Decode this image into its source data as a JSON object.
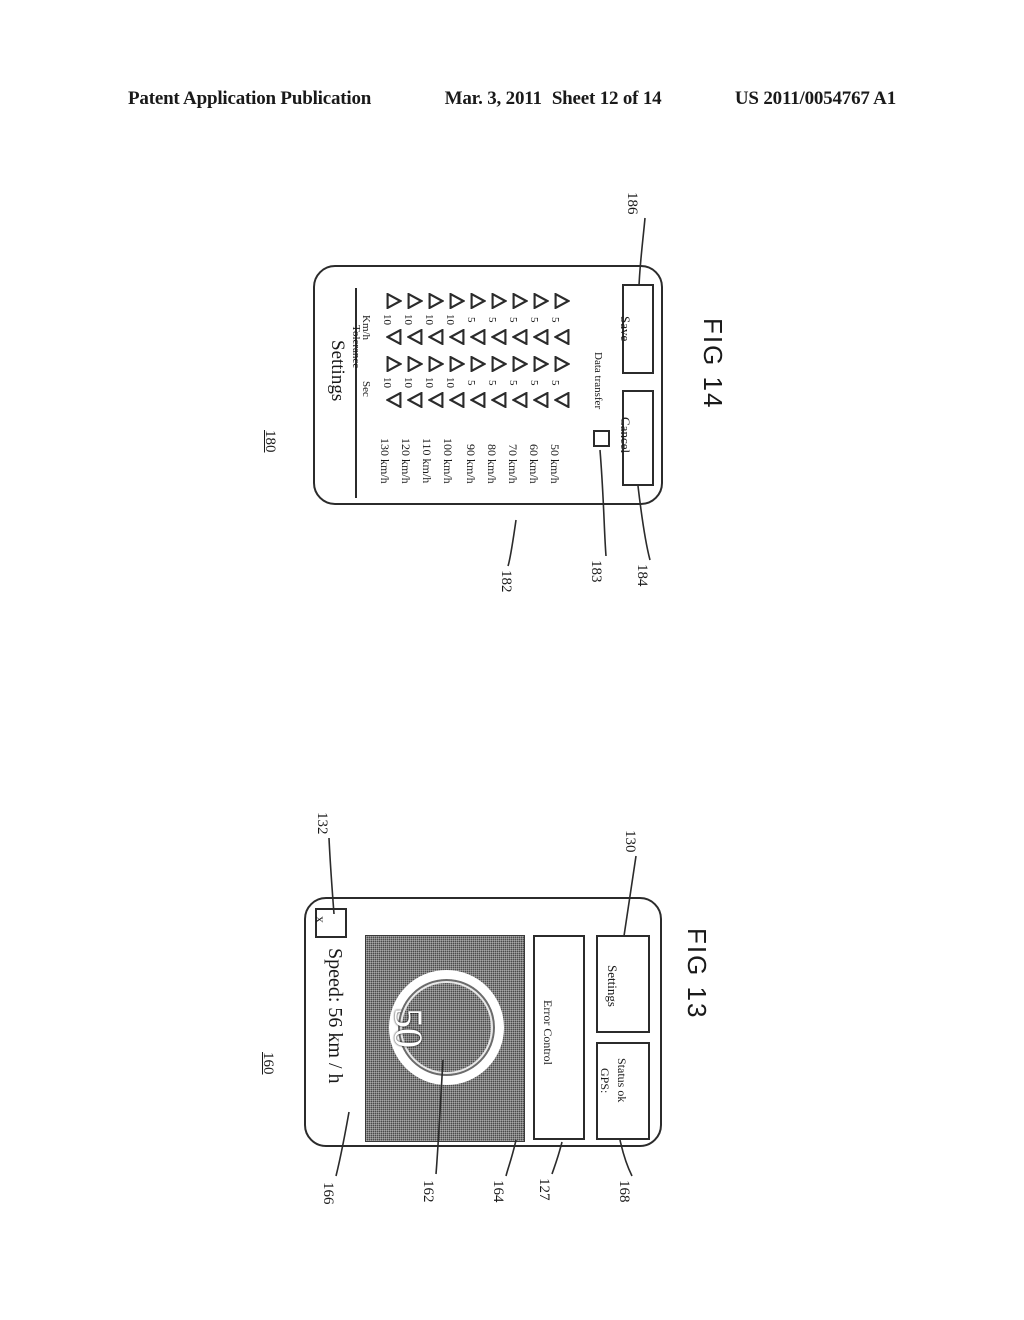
{
  "page": {
    "header_left": "Patent Application Publication",
    "header_date": "Mar. 3, 2011",
    "header_sheet": "Sheet 12 of 14",
    "header_pub": "US 2011/0054767 A1"
  },
  "fig14": {
    "caption": "FIG 14",
    "device_ref": "180",
    "title": "Settings",
    "col_header_tolerance": "Tolerance",
    "col_header_kmh": "Km/h",
    "col_header_sec": "Sec",
    "rows": [
      {
        "speed": "130 km/h",
        "sec": "10",
        "kmh": "10"
      },
      {
        "speed": "120 km/h",
        "sec": "10",
        "kmh": "10"
      },
      {
        "speed": "110 km/h",
        "sec": "10",
        "kmh": "10"
      },
      {
        "speed": "100 km/h",
        "sec": "10",
        "kmh": "10"
      },
      {
        "speed": "90 km/h",
        "sec": "5",
        "kmh": "5"
      },
      {
        "speed": "80 km/h",
        "sec": "5",
        "kmh": "5"
      },
      {
        "speed": "70 km/h",
        "sec": "5",
        "kmh": "5"
      },
      {
        "speed": "60 km/h",
        "sec": "5",
        "kmh": "5"
      },
      {
        "speed": "50 km/h",
        "sec": "5",
        "kmh": "5"
      }
    ],
    "data_transfer_label": "Data transfer",
    "data_transfer_checked": false,
    "save_label": "Save",
    "cancel_label": "Cancel",
    "ref_rows": "182",
    "ref_checkbox": "183",
    "ref_cancel": "184",
    "ref_save": "186"
  },
  "fig13": {
    "caption": "FIG 13",
    "device_ref": "160",
    "speed_label": "Speed: 56 km / h",
    "close_label": "x",
    "gauge_value": "50",
    "error_control_label": "Error Control",
    "settings_label": "Settings",
    "gps_label": "GPS:",
    "gps_status": "Status ok",
    "ref_speed_label": "166",
    "ref_gauge_value": "162",
    "ref_gauge_panel": "164",
    "ref_error_control": "127",
    "ref_gps": "168",
    "ref_close": "132",
    "ref_settings": "130"
  }
}
